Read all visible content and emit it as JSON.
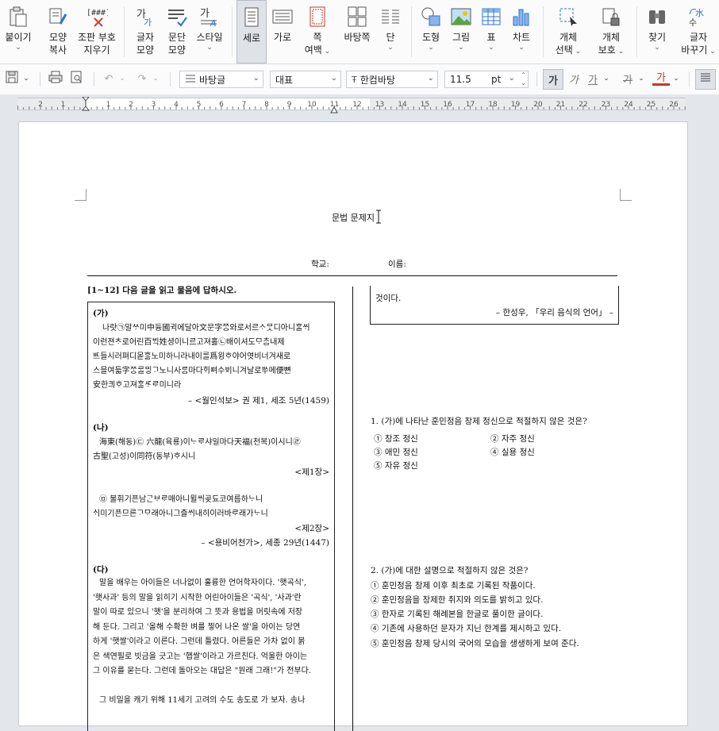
{
  "ribbon": {
    "items": [
      {
        "name": "paste-button",
        "line1": "붙이기",
        "line2": "",
        "chev": true
      },
      {
        "name": "format-copy-button",
        "line1": "모양",
        "line2": "복사",
        "chev": false
      },
      {
        "name": "clear-typesetting-button",
        "line1": "조판 부호",
        "line2": "지우기",
        "chev": false
      },
      {
        "name": "char-shape-button",
        "line1": "글자",
        "line2": "모양",
        "chev": false
      },
      {
        "name": "para-shape-button",
        "line1": "문단",
        "line2": "모양",
        "chev": false
      },
      {
        "name": "style-button",
        "line1": "스타일",
        "line2": "",
        "chev": true
      },
      {
        "name": "portrait-button",
        "line1": "세로",
        "line2": "",
        "chev": false
      },
      {
        "name": "landscape-button",
        "line1": "가로",
        "line2": "",
        "chev": false
      },
      {
        "name": "page-margin-button",
        "line1": "쪽",
        "line2": "여백",
        "chev": true
      },
      {
        "name": "page-bg-button",
        "line1": "바탕쪽",
        "line2": "",
        "chev": false
      },
      {
        "name": "columns-button",
        "line1": "단",
        "line2": "",
        "chev": true
      },
      {
        "name": "shape-button",
        "line1": "도형",
        "line2": "",
        "chev": true
      },
      {
        "name": "picture-button",
        "line1": "그림",
        "line2": "",
        "chev": true
      },
      {
        "name": "table-button",
        "line1": "표",
        "line2": "",
        "chev": true
      },
      {
        "name": "chart-button",
        "line1": "차트",
        "line2": "",
        "chev": true
      },
      {
        "name": "object-select-button",
        "line1": "개체",
        "line2": "선택",
        "chev": true
      },
      {
        "name": "object-protect-button",
        "line1": "개체",
        "line2": "보호",
        "chev": true
      },
      {
        "name": "find-button",
        "line1": "찾기",
        "line2": "",
        "chev": true
      },
      {
        "name": "replace-button",
        "line1": "글자",
        "line2": "바꾸기",
        "chev": true
      }
    ]
  },
  "toolbar": {
    "style_combo": "바탕글",
    "lang_combo": "대표",
    "font_combo": "한컴바탕",
    "size_value": "11.5",
    "size_unit": "pt",
    "bold": "가",
    "italic": "가",
    "underline": "가",
    "strike": "가",
    "color": "가"
  },
  "ruler": {
    "labels": [
      "2",
      "1",
      "1",
      "2",
      "3",
      "4",
      "5",
      "6",
      "7",
      "8",
      "9",
      "10",
      "11",
      "12",
      "13",
      "14",
      "15",
      "16",
      "17",
      "18",
      "19",
      "20",
      "21",
      "22",
      "23",
      "24",
      "25",
      "26"
    ]
  },
  "doc": {
    "title": "문법 문제지",
    "school_label": "학교:",
    "name_label": "이름:",
    "instruction": "[1~12] 다음 글을 읽고 물음에 답하시오.",
    "ga_label": "(가)",
    "ga_lines": [
      "나랏㉠말ᄊᆞ미中듕國귁에달아文문字ᄍᆞᆼ와로서르ᄉᆞᄆᆞᆺ디아니ᄒᆞᆯᄊᆡ",
      "이런젼ᄎᆞ로어린百ᄇᆡᆨ姓셩이니르고져홇㉡배이셔도ᄆᆞᄎᆞᆷ내제",
      "ᄠᅳ들시러펴디몯ᄒᆞᇙ노미하니라내이ᄅᆞᆯ爲윙ᄒᆞ야어엿비너겨새로",
      "스믈여듧字ᄍᆞᆼᄅᆞᆯᄆᆡᇰᄀᆞ노니사ᄅᆞᆷ마다ᄒᆡᅇᅧ수ᄫᅵ니겨날로ᄡᅮ메便뼌",
      "安한킈ᄒᆞ고져ᄒᆞᇙᄯᆞᄅᆞ미니라"
    ],
    "ga_source": "– <월인석보> 권 제1, 세조 5년(1459)",
    "na_label": "(나)",
    "na_lines1": [
      "海東(해동)㉢ 六龍(육룡)이ᄂᆞᄅᆞ샤일마다天福(천복)이시니㉣",
      "古聖(고성)이同符(동부)ᄒᆞ시니"
    ],
    "na_ch1": "<제1장>",
    "na_lines2": [
      "㉤ 불휘기픈남ᄀᆞᆫᄇᆞᄅᆞ매아니뮐ᄊᆡ곶됴코여름하ᄂᆞ니",
      "ᄉᆡ미기픈므른ᄀᆞᄆᆞ래아니그츨ᄊᆡ내히이러바ᄅᆞ래가ᄂᆞ니"
    ],
    "na_ch2": "<제2장>",
    "na_source": "– <용비어천가>, 세종 29년(1447)",
    "da_label": "(다)",
    "da_lines": [
      "말을 배우는 아이들은 너나없이 훌륭한 언어학자이다. '햇곡식',",
      "'햇사과' 등의 말을 읽히기 시작한 어린아이들은 '곡식', '사과'란",
      "말이 따로 있으니 '햇'을 분리하여 그 뜻과 용법을 머릿속에 저장",
      "해 둔다. 그리고 '올해 수확한 벼를 찧어 나온 쌀'을 아이는 당연",
      "하게 '햇쌀'이라고 이른다. 그런데 틀렸다. 어른들은 가차 없이 붉",
      "은 색연필로 빗금을 긋고는 '햅쌀'이라고 가르친다. 억울한 아이는",
      "그 이유를 묻는다. 그런데 돌아오는 대답은 \"원래 그래!\"가 전부다."
    ],
    "da_last": "그 비밀을 캐기 위해 11세기 고려의 수도 송도로 가 보자. 송나",
    "right_top": "것이다.",
    "right_source": "– 한성우, 「우리 음식의 언어」 –",
    "q1": "1. (가)에 나타난 훈민정음 창제 정신으로 적절하지 않은 것은?",
    "q1_opts": [
      "① 창조 정신",
      "② 자주 정신",
      "③ 애민 정신",
      "④ 실용 정신",
      "⑤ 자유 정신"
    ],
    "q2": "2. (가)에 대한 설명으로 적절하지 않은 것은?",
    "q2_opts": [
      "① 훈민정음 창제 이후 최초로 기록된 작품이다.",
      "② 훈민정음을 창제한 취지와 의도를 밝히고 있다.",
      "③ 한자로 기록된 해례본을 한글로 풀이한 글이다.",
      "④ 기존에 사용하던 문자가 지닌 한계를 제시하고 있다.",
      "⑤ 훈민정음 창제 당시의 국어의 모습을 생생하게 보여 준다."
    ]
  }
}
